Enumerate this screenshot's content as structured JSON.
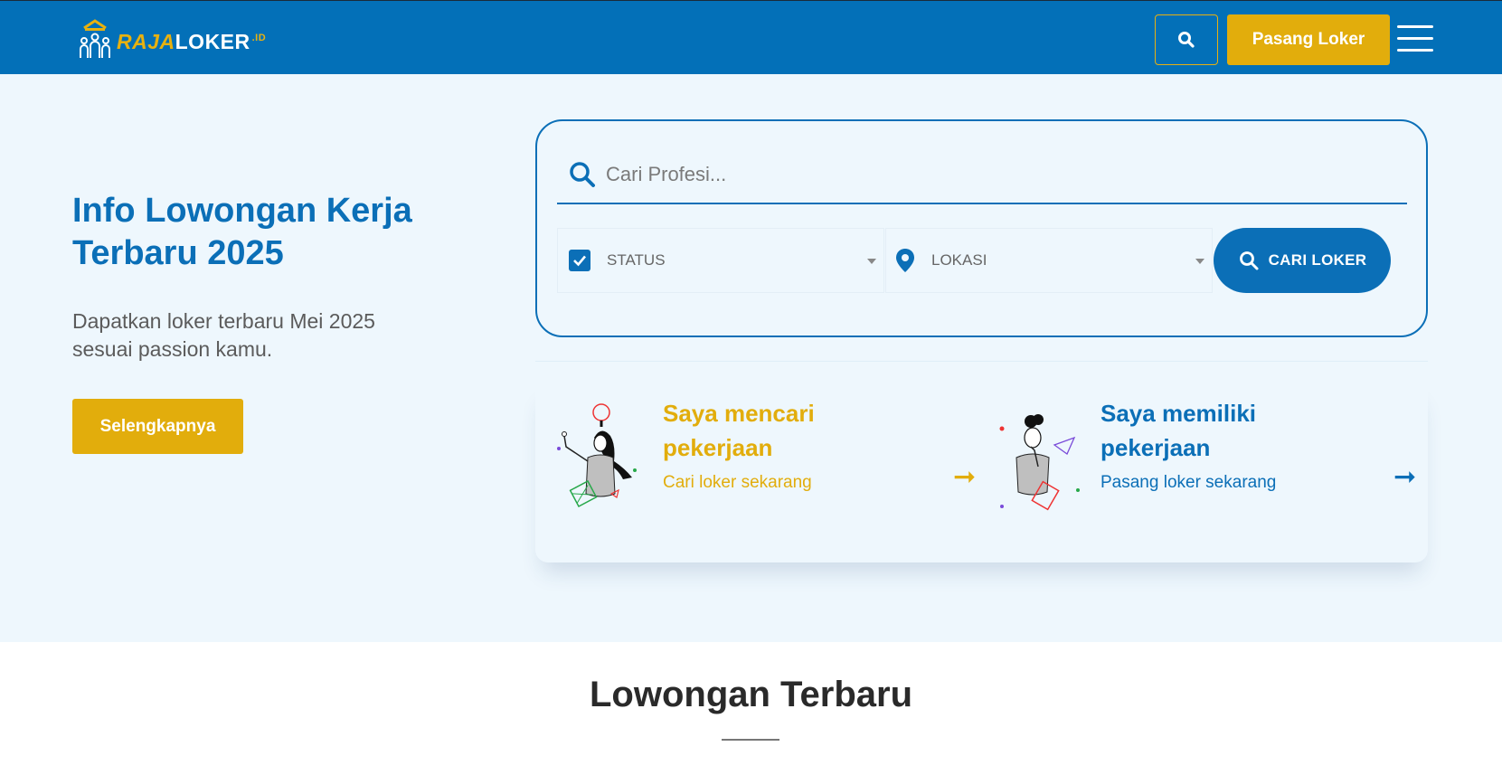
{
  "header": {
    "logo_raja": "RAJA",
    "logo_loker": "LOKER",
    "logo_id": ".ID",
    "search_icon": "search-icon",
    "pasang_label": "Pasang Loker",
    "menu_icon": "hamburger-menu-icon"
  },
  "hero": {
    "title": "Info Lowongan Kerja Terbaru 2025",
    "subtitle": "Dapatkan loker terbaru Mei 2025 sesuai passion kamu.",
    "more_label": "Selengkapnya"
  },
  "search": {
    "placeholder": "Cari Profesi...",
    "status_label": "STATUS",
    "lokasi_label": "LOKASI",
    "cari_label": "CARI LOKER"
  },
  "choices": [
    {
      "title": "Saya mencari pekerjaan",
      "subtitle": "Cari loker sekarang",
      "arrow": "➞",
      "color": "#e2ad0c"
    },
    {
      "title": "Saya memiliki pekerjaan",
      "subtitle": "Pasang loker sekarang",
      "arrow": "➞",
      "color": "#0b6fb7"
    }
  ],
  "section": {
    "title": "Lowongan Terbaru"
  },
  "colors": {
    "brand_blue": "#0370b8",
    "accent_yellow": "#e2ad0c",
    "hero_bg": "#eef7fd"
  }
}
